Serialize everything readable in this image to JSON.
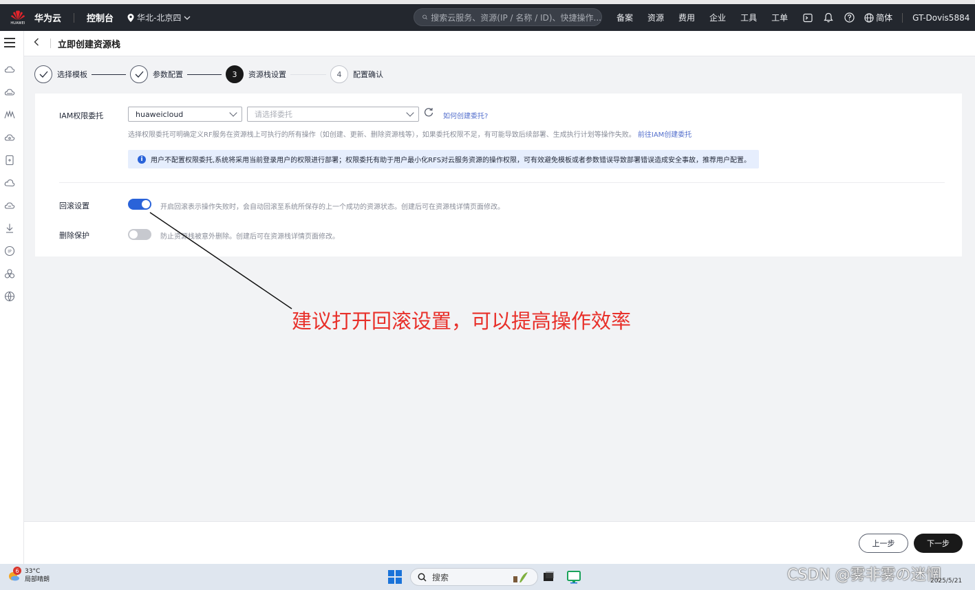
{
  "topbar": {
    "brand": "华为云",
    "logo_caption": "HUAWEI",
    "console": "控制台",
    "region": "华北-北京四",
    "search_placeholder": "搜索云服务、资源(IP / 名称 / ID)、快捷操作...",
    "links": [
      "备案",
      "资源",
      "费用",
      "企业",
      "工具",
      "工单"
    ],
    "language": "简体",
    "username": "GT-Dovis5884"
  },
  "header": {
    "title": "立即创建资源栈"
  },
  "steps": [
    {
      "number": "1",
      "label": "选择模板",
      "status": "done"
    },
    {
      "number": "2",
      "label": "参数配置",
      "status": "done"
    },
    {
      "number": "3",
      "label": "资源栈设置",
      "status": "active"
    },
    {
      "number": "4",
      "label": "配置确认",
      "status": "todo"
    }
  ],
  "form": {
    "iam": {
      "label": "IAM权限委托",
      "provider_value": "huaweicloud",
      "delegation_placeholder": "请选择委托",
      "how_link": "如何创建委托?",
      "hint": "选择权限委托可明确定义RF服务在资源栈上可执行的所有操作（如创建、更新、删除资源栈等），如果委托权限不足，有可能导致后续部署、生成执行计划等操作失败。",
      "hint_link": "前往IAM创建委托",
      "info": "用户不配置权限委托,系统将采用当前登录用户的权限进行部署；权限委托有助于用户最小化RFS对云服务资源的操作权限，可有效避免模板或者参数错误导致部署错误造成安全事故，推荐用户配置。"
    },
    "rollback": {
      "label": "回滚设置",
      "enabled": true,
      "description": "开启回滚表示操作失败时，会自动回滚至系统所保存的上一个成功的资源状态。创建后可在资源栈详情页面修改。"
    },
    "deletion_protection": {
      "label": "删除保护",
      "enabled": false,
      "description": "防止资源栈被意外删除。创建后可在资源栈详情页面修改。"
    }
  },
  "annotation": {
    "text": "建议打开回滚设置，可以提高操作效率",
    "color": "#e8302a"
  },
  "footer": {
    "prev_label": "上一步",
    "next_label": "下一步"
  },
  "taskbar": {
    "temperature": "33°C",
    "weather": "局部晴朗",
    "weather_badge": "6",
    "search_label": "搜索",
    "watermark": "CSDN @雾非雾の迷惘",
    "date": "2025/5/21"
  },
  "colors": {
    "primary": "#2a63d9",
    "topbar": "#23272e",
    "dark_button": "#191919",
    "link": "#526ecc"
  }
}
